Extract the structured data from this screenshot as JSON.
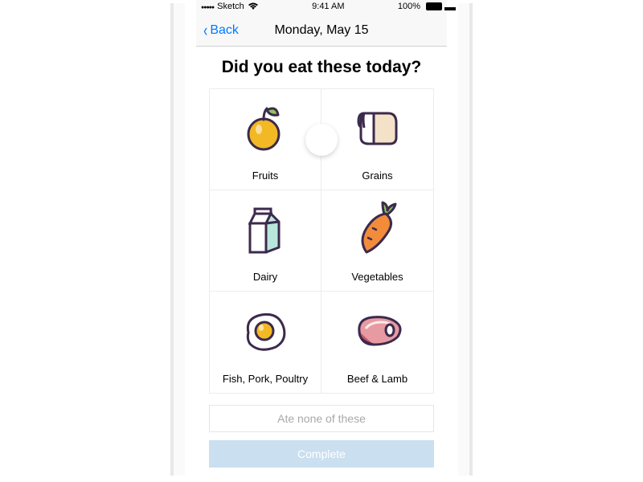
{
  "status": {
    "carrier": "Sketch",
    "time": "9:41 AM",
    "battery": "100%"
  },
  "nav": {
    "back_label": "Back",
    "title": "Monday, May 15"
  },
  "heading": "Did you eat these today?",
  "tiles": [
    {
      "label": "Fruits"
    },
    {
      "label": "Grains"
    },
    {
      "label": "Dairy"
    },
    {
      "label": "Vegetables"
    },
    {
      "label": "Fish, Pork, Poultry"
    },
    {
      "label": "Beef & Lamb"
    }
  ],
  "none_label": "Ate none of these",
  "complete_label": "Complete"
}
